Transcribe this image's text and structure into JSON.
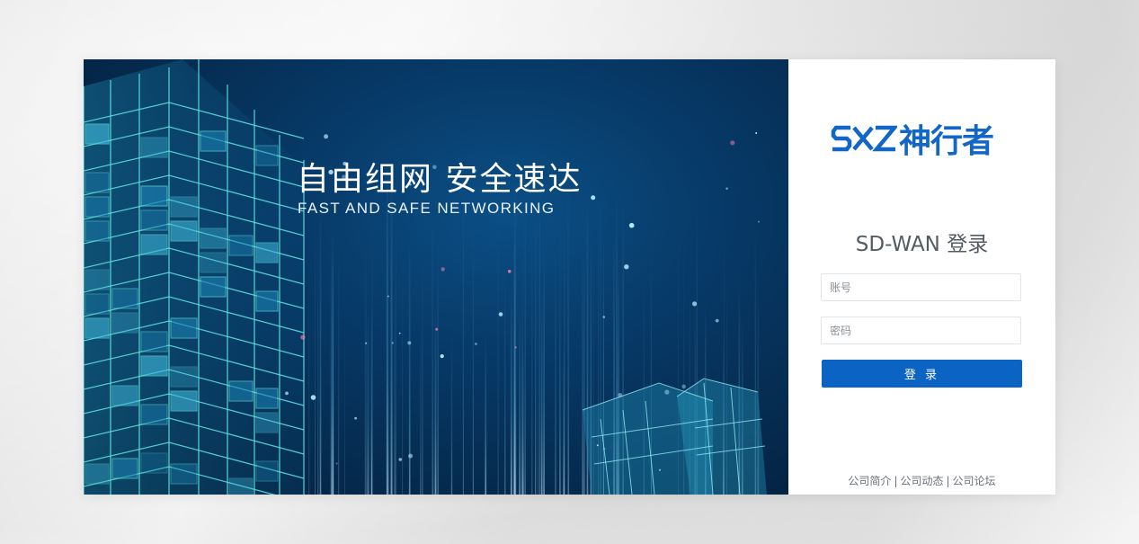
{
  "hero": {
    "title": "自由组网 安全速达",
    "subtitle": "FAST AND SAFE NETWORKING"
  },
  "brand": {
    "logo_latin": "SXZ",
    "logo_cn": "神行者",
    "color": "#1266c5"
  },
  "login": {
    "title": "SD-WAN 登录",
    "account_placeholder": "账号",
    "password_placeholder": "密码",
    "submit_label": "登 录",
    "button_color": "#0b63c4"
  },
  "footer": {
    "links": [
      "公司简介",
      "公司动态",
      "公司论坛"
    ],
    "separator": "|"
  }
}
